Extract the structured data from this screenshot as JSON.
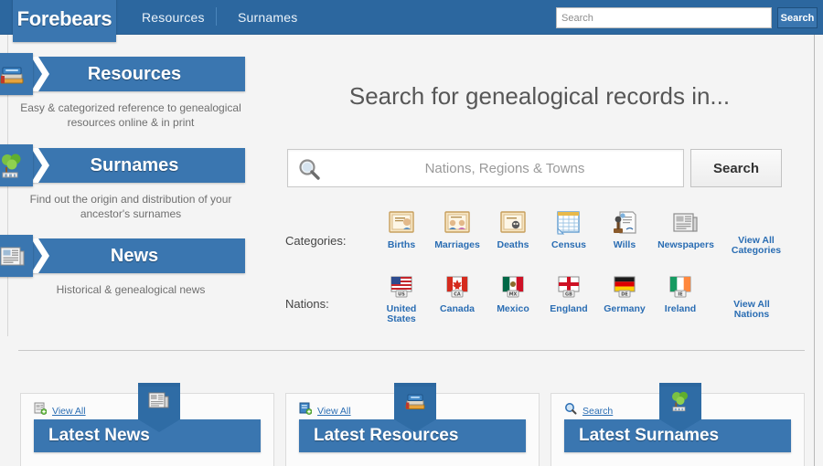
{
  "site": {
    "logo": "Forebears",
    "brand_blue": "#3a76b0",
    "header_blue": "#2c679f",
    "link_blue": "#2a6db3"
  },
  "topbar": {
    "nav": [
      {
        "label": "Resources",
        "name": "nav-resources"
      },
      {
        "label": "Surnames",
        "name": "nav-surnames"
      }
    ],
    "search_placeholder": "Search",
    "search_value": "",
    "search_button": "Search"
  },
  "sidebar": {
    "blocks": [
      {
        "title": "Resources",
        "icon": "books-icon",
        "description": "Easy & categorized reference to genealogical resources online & in print"
      },
      {
        "title": "Surnames",
        "icon": "family-tree-icon",
        "description": "Find out the origin and distribution of your ancestor's surnames"
      },
      {
        "title": "News",
        "icon": "newspaper-icon",
        "description": "Historical & genealogical news"
      }
    ]
  },
  "main": {
    "title": "Search for genealogical records in...",
    "search_placeholder": "Nations, Regions & Towns",
    "search_value": "",
    "search_button": "Search",
    "categories_label": "Categories:",
    "categories": [
      {
        "label": "Births",
        "icon": "birth-certificate-icon"
      },
      {
        "label": "Marriages",
        "icon": "marriage-certificate-icon"
      },
      {
        "label": "Deaths",
        "icon": "death-certificate-icon"
      },
      {
        "label": "Census",
        "icon": "census-table-icon"
      },
      {
        "label": "Wills",
        "icon": "will-seal-icon"
      },
      {
        "label": "Newspapers",
        "icon": "newspapers-icon"
      }
    ],
    "categories_view_all": "View All Categories",
    "nations_label": "Nations:",
    "nations": [
      {
        "label": "United States",
        "code": "US",
        "icon": "flag-us-icon"
      },
      {
        "label": "Canada",
        "code": "CA",
        "icon": "flag-ca-icon"
      },
      {
        "label": "Mexico",
        "code": "MX",
        "icon": "flag-mx-icon"
      },
      {
        "label": "England",
        "code": "GB",
        "icon": "flag-gb-icon"
      },
      {
        "label": "Germany",
        "code": "DE",
        "icon": "flag-de-icon"
      },
      {
        "label": "Ireland",
        "code": "IE",
        "icon": "flag-ie-icon"
      }
    ],
    "nations_view_all": "View All Nations"
  },
  "panels": [
    {
      "title": "Latest News",
      "link": "View All",
      "link_icon": "news-add-icon",
      "badge_icon": "newspaper-icon"
    },
    {
      "title": "Latest Resources",
      "link": "View All",
      "link_icon": "book-add-icon",
      "badge_icon": "books-icon"
    },
    {
      "title": "Latest Surnames",
      "link": "Search",
      "link_icon": "magnifier-icon",
      "badge_icon": "family-tree-icon"
    }
  ]
}
